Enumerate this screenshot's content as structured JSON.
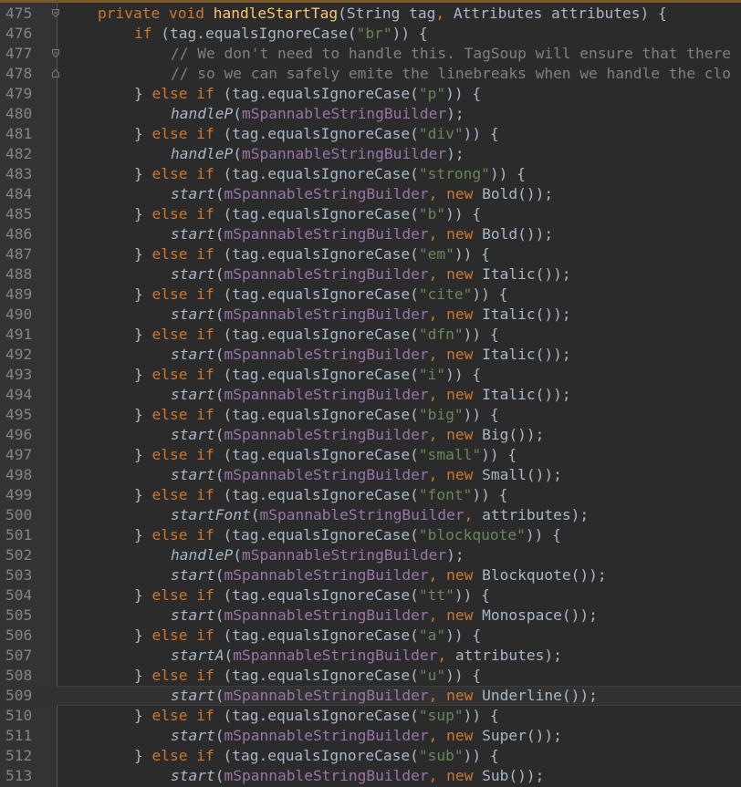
{
  "editor": {
    "lines": [
      {
        "num": "475",
        "indent": 1,
        "fold": "minus",
        "tokens": [
          {
            "t": "private ",
            "c": "kw"
          },
          {
            "t": "void ",
            "c": "kw"
          },
          {
            "t": "handleStartTag",
            "c": "fn"
          },
          {
            "t": "(String tag",
            "c": "plain"
          },
          {
            "t": ", ",
            "c": "kw"
          },
          {
            "t": "Attributes attributes) {",
            "c": "plain"
          }
        ]
      },
      {
        "num": "476",
        "indent": 2,
        "tokens": [
          {
            "t": "if ",
            "c": "kw"
          },
          {
            "t": "(tag.equalsIgnoreCase(",
            "c": "plain"
          },
          {
            "t": "\"br\"",
            "c": "str"
          },
          {
            "t": ")) {",
            "c": "plain"
          }
        ]
      },
      {
        "num": "477",
        "indent": 3,
        "fold": "minus",
        "tokens": [
          {
            "t": "// We don't need to handle this. TagSoup will ensure that there",
            "c": "cmt"
          }
        ]
      },
      {
        "num": "478",
        "indent": 3,
        "fold": "end",
        "tokens": [
          {
            "t": "// so we can safely emite the linebreaks when we handle the clo",
            "c": "cmt"
          }
        ]
      },
      {
        "num": "479",
        "indent": 2,
        "tokens": [
          {
            "t": "} ",
            "c": "plain"
          },
          {
            "t": "else if ",
            "c": "kw"
          },
          {
            "t": "(tag.equalsIgnoreCase(",
            "c": "plain"
          },
          {
            "t": "\"p\"",
            "c": "str"
          },
          {
            "t": ")) {",
            "c": "plain"
          }
        ]
      },
      {
        "num": "480",
        "indent": 3,
        "tokens": [
          {
            "t": "handleP",
            "c": "ital"
          },
          {
            "t": "(",
            "c": "plain"
          },
          {
            "t": "mSpannableStringBuilder",
            "c": "fld"
          },
          {
            "t": ");",
            "c": "plain"
          }
        ]
      },
      {
        "num": "481",
        "indent": 2,
        "tokens": [
          {
            "t": "} ",
            "c": "plain"
          },
          {
            "t": "else if ",
            "c": "kw"
          },
          {
            "t": "(tag.equalsIgnoreCase(",
            "c": "plain"
          },
          {
            "t": "\"div\"",
            "c": "str"
          },
          {
            "t": ")) {",
            "c": "plain"
          }
        ]
      },
      {
        "num": "482",
        "indent": 3,
        "tokens": [
          {
            "t": "handleP",
            "c": "ital"
          },
          {
            "t": "(",
            "c": "plain"
          },
          {
            "t": "mSpannableStringBuilder",
            "c": "fld"
          },
          {
            "t": ");",
            "c": "plain"
          }
        ]
      },
      {
        "num": "483",
        "indent": 2,
        "tokens": [
          {
            "t": "} ",
            "c": "plain"
          },
          {
            "t": "else if ",
            "c": "kw"
          },
          {
            "t": "(tag.equalsIgnoreCase(",
            "c": "plain"
          },
          {
            "t": "\"strong\"",
            "c": "str"
          },
          {
            "t": ")) {",
            "c": "plain"
          }
        ]
      },
      {
        "num": "484",
        "indent": 3,
        "tokens": [
          {
            "t": "start",
            "c": "ital"
          },
          {
            "t": "(",
            "c": "plain"
          },
          {
            "t": "mSpannableStringBuilder",
            "c": "fld"
          },
          {
            "t": ", ",
            "c": "kw"
          },
          {
            "t": "new ",
            "c": "kw"
          },
          {
            "t": "Bold());",
            "c": "plain"
          }
        ]
      },
      {
        "num": "485",
        "indent": 2,
        "tokens": [
          {
            "t": "} ",
            "c": "plain"
          },
          {
            "t": "else if ",
            "c": "kw"
          },
          {
            "t": "(tag.equalsIgnoreCase(",
            "c": "plain"
          },
          {
            "t": "\"b\"",
            "c": "str"
          },
          {
            "t": ")) {",
            "c": "plain"
          }
        ]
      },
      {
        "num": "486",
        "indent": 3,
        "tokens": [
          {
            "t": "start",
            "c": "ital"
          },
          {
            "t": "(",
            "c": "plain"
          },
          {
            "t": "mSpannableStringBuilder",
            "c": "fld"
          },
          {
            "t": ", ",
            "c": "kw"
          },
          {
            "t": "new ",
            "c": "kw"
          },
          {
            "t": "Bold());",
            "c": "plain"
          }
        ]
      },
      {
        "num": "487",
        "indent": 2,
        "tokens": [
          {
            "t": "} ",
            "c": "plain"
          },
          {
            "t": "else if ",
            "c": "kw"
          },
          {
            "t": "(tag.equalsIgnoreCase(",
            "c": "plain"
          },
          {
            "t": "\"em\"",
            "c": "str"
          },
          {
            "t": ")) {",
            "c": "plain"
          }
        ]
      },
      {
        "num": "488",
        "indent": 3,
        "tokens": [
          {
            "t": "start",
            "c": "ital"
          },
          {
            "t": "(",
            "c": "plain"
          },
          {
            "t": "mSpannableStringBuilder",
            "c": "fld"
          },
          {
            "t": ", ",
            "c": "kw"
          },
          {
            "t": "new ",
            "c": "kw"
          },
          {
            "t": "Italic());",
            "c": "plain"
          }
        ]
      },
      {
        "num": "489",
        "indent": 2,
        "tokens": [
          {
            "t": "} ",
            "c": "plain"
          },
          {
            "t": "else if ",
            "c": "kw"
          },
          {
            "t": "(tag.equalsIgnoreCase(",
            "c": "plain"
          },
          {
            "t": "\"cite\"",
            "c": "str"
          },
          {
            "t": ")) {",
            "c": "plain"
          }
        ]
      },
      {
        "num": "490",
        "indent": 3,
        "tokens": [
          {
            "t": "start",
            "c": "ital"
          },
          {
            "t": "(",
            "c": "plain"
          },
          {
            "t": "mSpannableStringBuilder",
            "c": "fld"
          },
          {
            "t": ", ",
            "c": "kw"
          },
          {
            "t": "new ",
            "c": "kw"
          },
          {
            "t": "Italic());",
            "c": "plain"
          }
        ]
      },
      {
        "num": "491",
        "indent": 2,
        "tokens": [
          {
            "t": "} ",
            "c": "plain"
          },
          {
            "t": "else if ",
            "c": "kw"
          },
          {
            "t": "(tag.equalsIgnoreCase(",
            "c": "plain"
          },
          {
            "t": "\"dfn\"",
            "c": "str"
          },
          {
            "t": ")) {",
            "c": "plain"
          }
        ]
      },
      {
        "num": "492",
        "indent": 3,
        "tokens": [
          {
            "t": "start",
            "c": "ital"
          },
          {
            "t": "(",
            "c": "plain"
          },
          {
            "t": "mSpannableStringBuilder",
            "c": "fld"
          },
          {
            "t": ", ",
            "c": "kw"
          },
          {
            "t": "new ",
            "c": "kw"
          },
          {
            "t": "Italic());",
            "c": "plain"
          }
        ]
      },
      {
        "num": "493",
        "indent": 2,
        "tokens": [
          {
            "t": "} ",
            "c": "plain"
          },
          {
            "t": "else if ",
            "c": "kw"
          },
          {
            "t": "(tag.equalsIgnoreCase(",
            "c": "plain"
          },
          {
            "t": "\"i\"",
            "c": "str"
          },
          {
            "t": ")) {",
            "c": "plain"
          }
        ]
      },
      {
        "num": "494",
        "indent": 3,
        "tokens": [
          {
            "t": "start",
            "c": "ital"
          },
          {
            "t": "(",
            "c": "plain"
          },
          {
            "t": "mSpannableStringBuilder",
            "c": "fld"
          },
          {
            "t": ", ",
            "c": "kw"
          },
          {
            "t": "new ",
            "c": "kw"
          },
          {
            "t": "Italic());",
            "c": "plain"
          }
        ]
      },
      {
        "num": "495",
        "indent": 2,
        "tokens": [
          {
            "t": "} ",
            "c": "plain"
          },
          {
            "t": "else if ",
            "c": "kw"
          },
          {
            "t": "(tag.equalsIgnoreCase(",
            "c": "plain"
          },
          {
            "t": "\"big\"",
            "c": "str"
          },
          {
            "t": ")) {",
            "c": "plain"
          }
        ]
      },
      {
        "num": "496",
        "indent": 3,
        "tokens": [
          {
            "t": "start",
            "c": "ital"
          },
          {
            "t": "(",
            "c": "plain"
          },
          {
            "t": "mSpannableStringBuilder",
            "c": "fld"
          },
          {
            "t": ", ",
            "c": "kw"
          },
          {
            "t": "new ",
            "c": "kw"
          },
          {
            "t": "Big());",
            "c": "plain"
          }
        ]
      },
      {
        "num": "497",
        "indent": 2,
        "tokens": [
          {
            "t": "} ",
            "c": "plain"
          },
          {
            "t": "else if ",
            "c": "kw"
          },
          {
            "t": "(tag.equalsIgnoreCase(",
            "c": "plain"
          },
          {
            "t": "\"small\"",
            "c": "str"
          },
          {
            "t": ")) {",
            "c": "plain"
          }
        ]
      },
      {
        "num": "498",
        "indent": 3,
        "tokens": [
          {
            "t": "start",
            "c": "ital"
          },
          {
            "t": "(",
            "c": "plain"
          },
          {
            "t": "mSpannableStringBuilder",
            "c": "fld"
          },
          {
            "t": ", ",
            "c": "kw"
          },
          {
            "t": "new ",
            "c": "kw"
          },
          {
            "t": "Small());",
            "c": "plain"
          }
        ]
      },
      {
        "num": "499",
        "indent": 2,
        "tokens": [
          {
            "t": "} ",
            "c": "plain"
          },
          {
            "t": "else if ",
            "c": "kw"
          },
          {
            "t": "(tag.equalsIgnoreCase(",
            "c": "plain"
          },
          {
            "t": "\"font\"",
            "c": "str"
          },
          {
            "t": ")) {",
            "c": "plain"
          }
        ]
      },
      {
        "num": "500",
        "indent": 3,
        "tokens": [
          {
            "t": "startFont",
            "c": "ital"
          },
          {
            "t": "(",
            "c": "plain"
          },
          {
            "t": "mSpannableStringBuilder",
            "c": "fld"
          },
          {
            "t": ", ",
            "c": "kw"
          },
          {
            "t": "attributes);",
            "c": "plain"
          }
        ]
      },
      {
        "num": "501",
        "indent": 2,
        "tokens": [
          {
            "t": "} ",
            "c": "plain"
          },
          {
            "t": "else if ",
            "c": "kw"
          },
          {
            "t": "(tag.equalsIgnoreCase(",
            "c": "plain"
          },
          {
            "t": "\"blockquote\"",
            "c": "str"
          },
          {
            "t": ")) {",
            "c": "plain"
          }
        ]
      },
      {
        "num": "502",
        "indent": 3,
        "tokens": [
          {
            "t": "handleP",
            "c": "ital"
          },
          {
            "t": "(",
            "c": "plain"
          },
          {
            "t": "mSpannableStringBuilder",
            "c": "fld"
          },
          {
            "t": ");",
            "c": "plain"
          }
        ]
      },
      {
        "num": "503",
        "indent": 3,
        "tokens": [
          {
            "t": "start",
            "c": "ital"
          },
          {
            "t": "(",
            "c": "plain"
          },
          {
            "t": "mSpannableStringBuilder",
            "c": "fld"
          },
          {
            "t": ", ",
            "c": "kw"
          },
          {
            "t": "new ",
            "c": "kw"
          },
          {
            "t": "Blockquote());",
            "c": "plain"
          }
        ]
      },
      {
        "num": "504",
        "indent": 2,
        "tokens": [
          {
            "t": "} ",
            "c": "plain"
          },
          {
            "t": "else if ",
            "c": "kw"
          },
          {
            "t": "(tag.equalsIgnoreCase(",
            "c": "plain"
          },
          {
            "t": "\"tt\"",
            "c": "str"
          },
          {
            "t": ")) {",
            "c": "plain"
          }
        ]
      },
      {
        "num": "505",
        "indent": 3,
        "tokens": [
          {
            "t": "start",
            "c": "ital"
          },
          {
            "t": "(",
            "c": "plain"
          },
          {
            "t": "mSpannableStringBuilder",
            "c": "fld"
          },
          {
            "t": ", ",
            "c": "kw"
          },
          {
            "t": "new ",
            "c": "kw"
          },
          {
            "t": "Monospace());",
            "c": "plain"
          }
        ]
      },
      {
        "num": "506",
        "indent": 2,
        "tokens": [
          {
            "t": "} ",
            "c": "plain"
          },
          {
            "t": "else if ",
            "c": "kw"
          },
          {
            "t": "(tag.equalsIgnoreCase(",
            "c": "plain"
          },
          {
            "t": "\"a\"",
            "c": "str"
          },
          {
            "t": ")) {",
            "c": "plain"
          }
        ]
      },
      {
        "num": "507",
        "indent": 3,
        "tokens": [
          {
            "t": "startA",
            "c": "ital"
          },
          {
            "t": "(",
            "c": "plain"
          },
          {
            "t": "mSpannableStringBuilder",
            "c": "fld"
          },
          {
            "t": ", ",
            "c": "kw"
          },
          {
            "t": "attributes);",
            "c": "plain"
          }
        ]
      },
      {
        "num": "508",
        "indent": 2,
        "tokens": [
          {
            "t": "} ",
            "c": "plain"
          },
          {
            "t": "else if ",
            "c": "kw"
          },
          {
            "t": "(tag.equalsIgnoreCase(",
            "c": "plain"
          },
          {
            "t": "\"u\"",
            "c": "str"
          },
          {
            "t": ")) {",
            "c": "plain"
          }
        ]
      },
      {
        "num": "509",
        "indent": 3,
        "current": true,
        "tokens": [
          {
            "t": "start",
            "c": "ital"
          },
          {
            "t": "(",
            "c": "plain"
          },
          {
            "t": "mSpannableStringBuilder",
            "c": "fld"
          },
          {
            "t": ", ",
            "c": "kw"
          },
          {
            "t": "new ",
            "c": "kw"
          },
          {
            "t": "Underline());",
            "c": "plain"
          }
        ]
      },
      {
        "num": "510",
        "indent": 2,
        "tokens": [
          {
            "t": "} ",
            "c": "plain"
          },
          {
            "t": "else if ",
            "c": "kw"
          },
          {
            "t": "(tag.equalsIgnoreCase(",
            "c": "plain"
          },
          {
            "t": "\"sup\"",
            "c": "str"
          },
          {
            "t": ")) {",
            "c": "plain"
          }
        ]
      },
      {
        "num": "511",
        "indent": 3,
        "tokens": [
          {
            "t": "start",
            "c": "ital"
          },
          {
            "t": "(",
            "c": "plain"
          },
          {
            "t": "mSpannableStringBuilder",
            "c": "fld"
          },
          {
            "t": ", ",
            "c": "kw"
          },
          {
            "t": "new ",
            "c": "kw"
          },
          {
            "t": "Super());",
            "c": "plain"
          }
        ]
      },
      {
        "num": "512",
        "indent": 2,
        "tokens": [
          {
            "t": "} ",
            "c": "plain"
          },
          {
            "t": "else if ",
            "c": "kw"
          },
          {
            "t": "(tag.equalsIgnoreCase(",
            "c": "plain"
          },
          {
            "t": "\"sub\"",
            "c": "str"
          },
          {
            "t": ")) {",
            "c": "plain"
          }
        ]
      },
      {
        "num": "513",
        "indent": 3,
        "tokens": [
          {
            "t": "start",
            "c": "ital"
          },
          {
            "t": "(",
            "c": "plain"
          },
          {
            "t": "mSpannableStringBuilder",
            "c": "fld"
          },
          {
            "t": ", ",
            "c": "kw"
          },
          {
            "t": "new ",
            "c": "kw"
          },
          {
            "t": "Sub());",
            "c": "plain"
          }
        ]
      }
    ]
  }
}
